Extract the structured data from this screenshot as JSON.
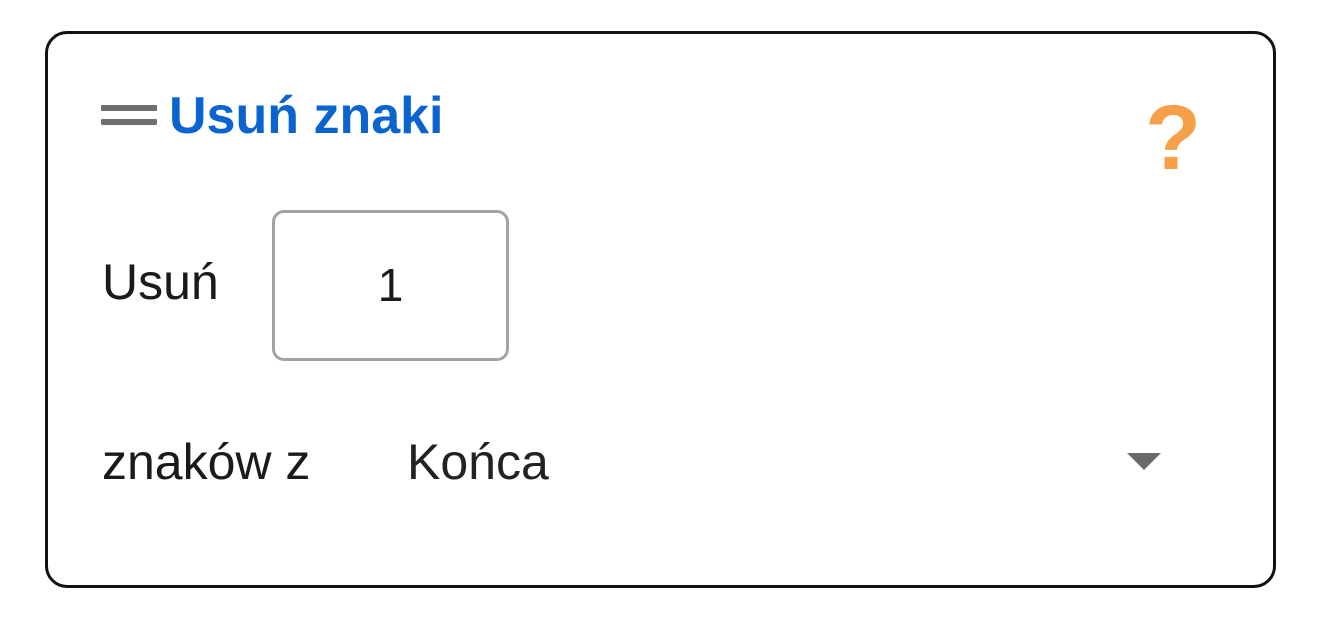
{
  "block": {
    "title": "Usuń znaki",
    "title_color": "#0a64d0",
    "help_icon": "?",
    "help_icon_color": "#f6a14a",
    "remove_label": "Usuń",
    "count_value": "1",
    "chars_from_label": "znaków z",
    "position_select": {
      "selected": "Końca"
    }
  }
}
